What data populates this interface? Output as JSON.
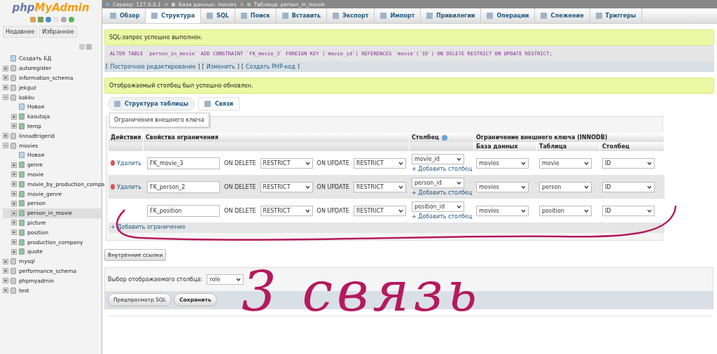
{
  "sidebar": {
    "logo": {
      "part_1": "php",
      "part_2": "MyAdmin"
    },
    "tabs": [
      {
        "label": "Недавнее",
        "selected": false
      },
      {
        "label": "Избранное",
        "selected": false
      }
    ],
    "tree": [
      {
        "label": "Создать БД",
        "kind": "new",
        "selected": false
      },
      {
        "label": "autoregister",
        "kind": "db",
        "expanded": false,
        "selected": false
      },
      {
        "label": "information_schema",
        "kind": "db",
        "expanded": false,
        "selected": false
      },
      {
        "label": "jekguz",
        "kind": "db",
        "expanded": false,
        "selected": false
      },
      {
        "label": "kokku",
        "kind": "db",
        "expanded": true,
        "selected": false,
        "children": [
          {
            "label": "Новая",
            "kind": "new",
            "selected": false
          },
          {
            "label": "kasutaja",
            "kind": "table",
            "selected": false
          },
          {
            "label": "temp",
            "kind": "table",
            "selected": false
          }
        ]
      },
      {
        "label": "linnadtrigerid",
        "kind": "db",
        "expanded": false,
        "selected": false
      },
      {
        "label": "movies",
        "kind": "db",
        "expanded": true,
        "selected": false,
        "children": [
          {
            "label": "Новая",
            "kind": "new",
            "selected": false
          },
          {
            "label": "genre",
            "kind": "table",
            "selected": false
          },
          {
            "label": "movie",
            "kind": "table",
            "selected": false
          },
          {
            "label": "movie_by_production_compa",
            "kind": "table",
            "selected": false
          },
          {
            "label": "movie_genre",
            "kind": "table",
            "selected": false
          },
          {
            "label": "person",
            "kind": "table",
            "selected": false
          },
          {
            "label": "person_in_movie",
            "kind": "table",
            "selected": true
          },
          {
            "label": "picture",
            "kind": "table",
            "selected": false
          },
          {
            "label": "position",
            "kind": "table",
            "selected": false
          },
          {
            "label": "production_company",
            "kind": "table",
            "selected": false
          },
          {
            "label": "quote",
            "kind": "table",
            "selected": false
          }
        ]
      },
      {
        "label": "mysql",
        "kind": "db",
        "expanded": false,
        "selected": false
      },
      {
        "label": "performance_schema",
        "kind": "db",
        "expanded": false,
        "selected": false
      },
      {
        "label": "phpmyadmin",
        "kind": "db",
        "expanded": false,
        "selected": false
      },
      {
        "label": "test",
        "kind": "db",
        "expanded": false,
        "selected": false
      }
    ]
  },
  "breadcrumb": [
    {
      "label": "Сервер: 127.0.0.1",
      "kind": "server"
    },
    {
      "label": "База данных: movies",
      "kind": "database"
    },
    {
      "label": "Таблица: person_in_movie",
      "kind": "table"
    }
  ],
  "tabs": [
    {
      "label": "Обзор",
      "selected": false
    },
    {
      "label": "Структура",
      "selected": true
    },
    {
      "label": "SQL",
      "selected": false
    },
    {
      "label": "Поиск",
      "selected": false
    },
    {
      "label": "Вставить",
      "selected": false
    },
    {
      "label": "Экспорт",
      "selected": false
    },
    {
      "label": "Импорт",
      "selected": false
    },
    {
      "label": "Привилегии",
      "selected": false
    },
    {
      "label": "Операции",
      "selected": false
    },
    {
      "label": "Слежение",
      "selected": false
    },
    {
      "label": "Триггеры",
      "selected": false
    }
  ],
  "success_message": "SQL-запрос успешно выполнен.",
  "sql_query": "ALTER TABLE `person_in_movie` ADD CONSTRAINT `FK_movie_3` FOREIGN KEY (`movie_id`) REFERENCES `movie`(`ID`) ON DELETE RESTRICT ON UPDATE RESTRICT;",
  "query_links": [
    {
      "open": "[",
      "label": "Построчное редактирование",
      "close": "]"
    },
    {
      "open": "[",
      "label": "Изменить",
      "close": "]"
    },
    {
      "open": "[",
      "label": "Создать PHP-код",
      "close": "]"
    }
  ],
  "update_message": "Отображаемый столбец был успешно обновлен.",
  "subtabs": [
    {
      "label": "Структура таблицы",
      "selected": true
    },
    {
      "label": "Связи",
      "selected": false
    }
  ],
  "fieldset_legend": "Ограничения внешнего ключа",
  "table": {
    "columns": {
      "actions": "Действия",
      "properties": "Свойства ограничения",
      "column": "Столбец",
      "foreign": "Ограничение внешнего ключа (INNODB)",
      "database": "База данных",
      "table": "Таблица",
      "ref_column": "Столбец"
    },
    "rows": [
      {
        "delete": "Удалить",
        "name": "FK_movie_3",
        "on_delete_label": "ON DELETE",
        "on_delete": "RESTRICT",
        "on_update_label": "ON UPDATE",
        "on_update": "RESTRICT",
        "column": "movie_id",
        "add_column": "+ Добавить столбец",
        "database": "movies",
        "table": "movie",
        "ref_column": "ID"
      },
      {
        "delete": "Удалить",
        "name": "FK_person_2",
        "on_delete_label": "ON DELETE",
        "on_delete": "RESTRICT",
        "on_update_label": "ON UPDATE",
        "on_update": "RESTRICT",
        "column": "person_id",
        "add_column": "+ Добавить столбец",
        "database": "movies",
        "table": "person",
        "ref_column": "ID"
      },
      {
        "name": "FK_position",
        "on_delete_label": "ON DELETE",
        "on_delete": "RESTRICT",
        "on_update_label": "ON UPDATE",
        "on_update": "RESTRICT",
        "column": "position_id",
        "add_column": "+ Добавить столбец",
        "database": "movies",
        "table": "position",
        "ref_column": "ID"
      }
    ],
    "add_constraint": "+ Добавить ограничение"
  },
  "internal_links_button": "Внутренние ссылки",
  "display_column": {
    "label": "Выбор отображаемого столбца:",
    "value": "role"
  },
  "buttons": [
    "Предпросмотр SQL",
    "Сохранить"
  ],
  "annotation": "3 связь"
}
